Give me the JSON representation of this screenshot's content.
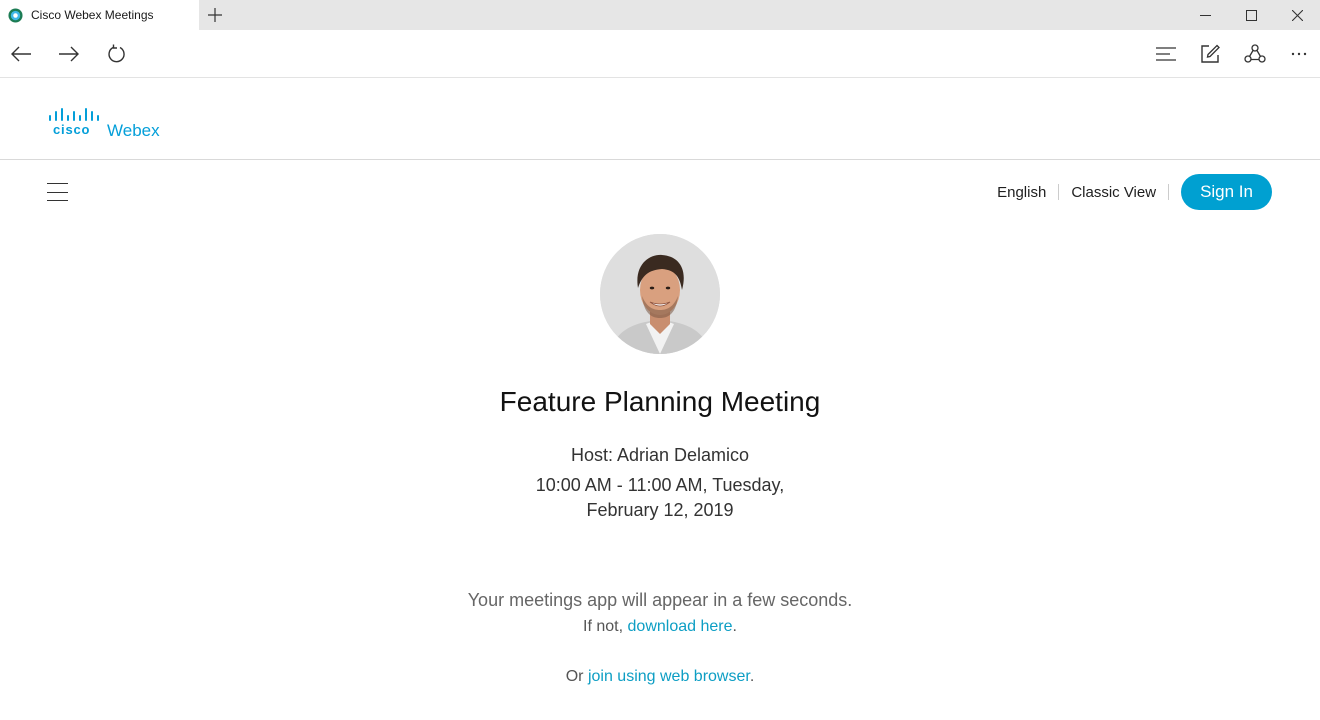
{
  "browser": {
    "tab_title": "Cisco Webex Meetings",
    "icons": {
      "favicon": "webex-favicon-icon",
      "new_tab": "plus-icon",
      "minimize": "minimize-icon",
      "maximize": "maximize-icon",
      "close": "close-icon",
      "back": "back-arrow-icon",
      "forward": "forward-arrow-icon",
      "refresh": "refresh-icon",
      "hub": "hub-icon",
      "notes": "web-note-icon",
      "share": "share-icon",
      "more": "more-icon"
    }
  },
  "header": {
    "logo_cisco": "cisco",
    "logo_product": "Webex"
  },
  "nav": {
    "language": "English",
    "classic_view": "Classic View",
    "sign_in": "Sign In"
  },
  "meeting": {
    "title": "Feature Planning Meeting",
    "host": "Host: Adrian Delamico",
    "time_line1": "10:00 AM - 11:00 AM, Tuesday,",
    "time_line2": "February 12, 2019"
  },
  "join": {
    "app_message": "Your meetings app will appear in a few seconds.",
    "if_not": "If not,",
    "download_link": "download here",
    "download_suffix": ".",
    "or_prefix": "Or",
    "web_link": "join using web browser",
    "web_suffix": "."
  },
  "colors": {
    "brand": "#049fd9",
    "sign_in_bg": "#00a0d1",
    "link": "#0d9ec4",
    "tab_strip": "#e6e6e6"
  }
}
